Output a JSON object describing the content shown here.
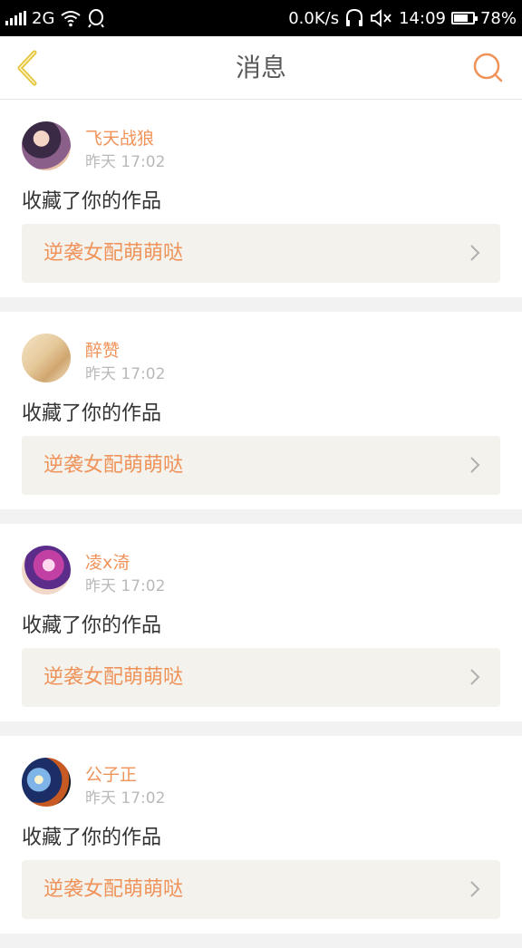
{
  "status_bar": {
    "network": "2G",
    "speed": "0.0K/s",
    "time": "14:09",
    "battery": "78%",
    "battery_level": 0.78
  },
  "header": {
    "title": "消息",
    "back_icon": "chevron-left-icon",
    "search_icon": "search-icon"
  },
  "messages": [
    {
      "username": "飞天战狼",
      "time": "昨天 17:02",
      "action": "收藏了你的作品",
      "work_title": "逆袭女配萌萌哒"
    },
    {
      "username": "醉赞",
      "time": "昨天 17:02",
      "action": "收藏了你的作品",
      "work_title": "逆袭女配萌萌哒"
    },
    {
      "username": "凌x渏",
      "time": "昨天 17:02",
      "action": "收藏了你的作品",
      "work_title": "逆袭女配萌萌哒"
    },
    {
      "username": "公子正",
      "time": "昨天 17:02",
      "action": "收藏了你的作品",
      "work_title": "逆袭女配萌萌哒"
    }
  ],
  "colors": {
    "accent": "#f0935a",
    "back_icon": "#e5c53a",
    "card_bg": "#ffffff",
    "work_bg": "#f3f2ed",
    "page_bg": "#f2f2f2"
  }
}
